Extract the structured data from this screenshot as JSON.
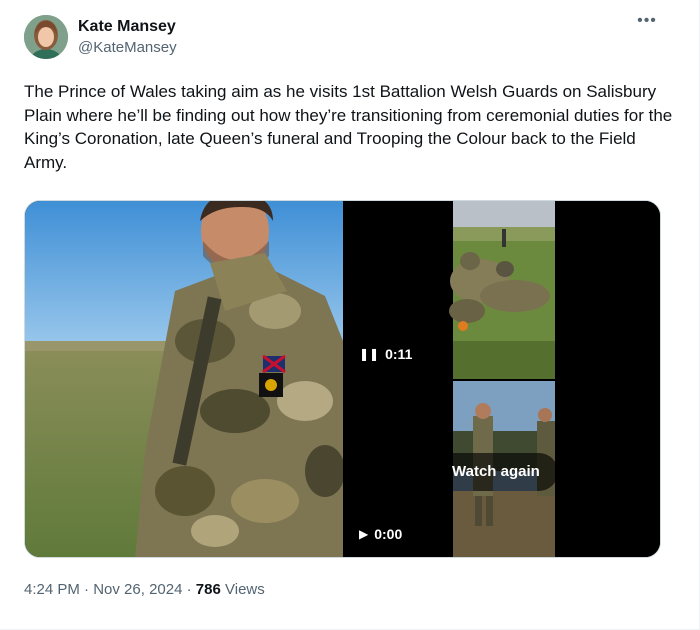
{
  "author": {
    "name": "Kate Mansey",
    "handle": "@KateMansey"
  },
  "more_icon": "more-horizontal-icon",
  "tweet_text": "The Prince of Wales taking aim as he visits 1st Battalion Welsh Guards on Salisbury Plain where he’ll be finding out how they’re transitioning from ceremonial duties for the King’s Coronation, late Queen’s funeral and Trooping the Colour back to the Field Army.",
  "media": {
    "video_top": {
      "state_icon": "pause-icon",
      "time": "0:11"
    },
    "video_bottom": {
      "state_icon": "play-icon",
      "time": "0:00",
      "overlay_label": "Watch again"
    }
  },
  "meta": {
    "time": "4:24 PM",
    "separator": " · ",
    "date": "Nov 26, 2024",
    "views_count": "786",
    "views_label": "Views"
  },
  "colors": {
    "text_primary": "#0f1419",
    "text_secondary": "#536471",
    "border": "#cfd9de"
  }
}
